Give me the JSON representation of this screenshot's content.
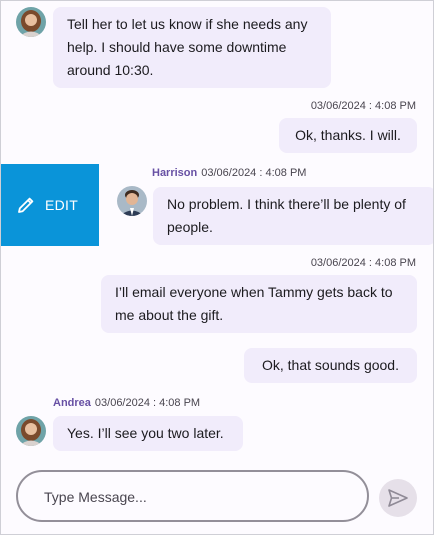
{
  "messages": [
    {
      "text": "Tell her to let us know if she needs any help. I should have some downtime around 10:30."
    },
    {
      "timestamp": "03/06/2024 : 4:08 PM",
      "text": "Ok, thanks. I will."
    },
    {
      "author": "Harrison",
      "timestamp": "03/06/2024 : 4:08 PM",
      "text": "No problem. I think there’ll be plenty of people."
    },
    {
      "timestamp": "03/06/2024 : 4:08 PM",
      "text": "I’ll email everyone when Tammy gets back to me about the gift."
    },
    {
      "text": "Ok, that sounds good."
    },
    {
      "author": "Andrea",
      "timestamp": "03/06/2024 : 4:08 PM",
      "text": "Yes. I’ll see you two later."
    }
  ],
  "swipe_action": {
    "label": "EDIT",
    "icon": "pencil-icon",
    "color": "#0a94d9"
  },
  "composer": {
    "placeholder": "Type Message...",
    "value": "",
    "send_icon": "send-icon"
  },
  "colors": {
    "bubble": "#f1ecfb",
    "author": "#6750a4",
    "background": "#fdfbff"
  }
}
